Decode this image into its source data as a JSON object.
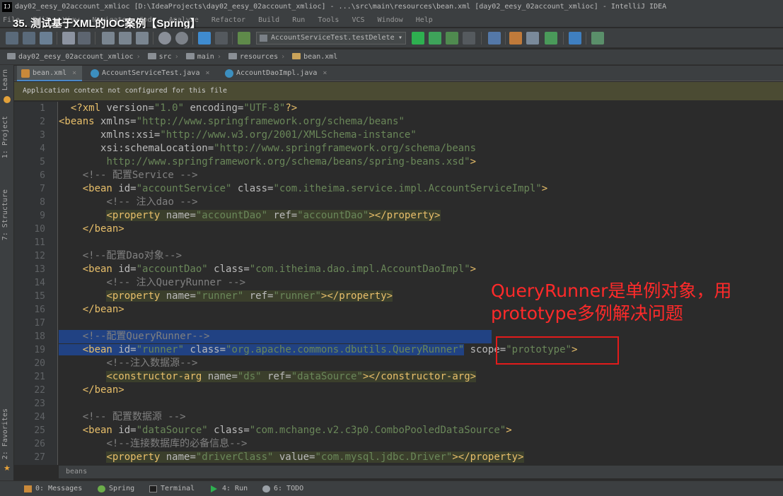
{
  "window": {
    "title": "day02_eesy_02account_xmlioc [D:\\IdeaProjects\\day02_eesy_02account_xmlioc] - ...\\src\\main\\resources\\bean.xml [day02_eesy_02account_xmlioc] - IntelliJ IDEA",
    "app_icon": "IJ"
  },
  "video_title": "35. 测试基于XML的IOC案例【Spring】",
  "menu": [
    "File",
    "Edit",
    "View",
    "Navigate",
    "Code",
    "Analyze",
    "Refactor",
    "Build",
    "Run",
    "Tools",
    "VCS",
    "Window",
    "Help"
  ],
  "toolbar": {
    "run_config": "AccountServiceTest.testDelete",
    "icons": [
      "save-icon",
      "sync-icon",
      "cut-icon",
      "copy-icon",
      "paste-icon",
      "find-icon",
      "replace-icon",
      "back-icon",
      "forward-icon",
      "build-icon",
      "run-icon",
      "debug-icon",
      "coverage-icon",
      "stop-icon",
      "structure-icon",
      "settings-icon",
      "project-structure-icon",
      "help-icon",
      "vm-icon"
    ]
  },
  "breadcrumb": [
    "day02_eesy_02account_xmlioc",
    "src",
    "main",
    "resources",
    "bean.xml"
  ],
  "left_stripe": {
    "learn": "Learn",
    "project": "1: Project",
    "structure": "7: Structure",
    "favorites": "2: Favorites"
  },
  "tabs": [
    {
      "label": "bean.xml",
      "active": true
    },
    {
      "label": "AccountServiceTest.java",
      "active": false
    },
    {
      "label": "AccountDaoImpl.java",
      "active": false
    }
  ],
  "notice": "Application context not configured for this file",
  "code": {
    "lines": [
      "1",
      "2",
      "3",
      "4",
      "5",
      "6",
      "7",
      "8",
      "9",
      "10",
      "11",
      "12",
      "13",
      "14",
      "15",
      "16",
      "17",
      "18",
      "19",
      "20",
      "21",
      "22",
      "23",
      "24",
      "25",
      "26",
      "27"
    ],
    "l1": {
      "a": "<?xml",
      "b": " version=",
      "c": "\"1.0\"",
      "d": " encoding=",
      "e": "\"UTF-8\"",
      "f": "?>"
    },
    "l2": {
      "a": "<beans",
      "b": " xmlns=",
      "c": "\"http://www.springframework.org/schema/beans\""
    },
    "l3": {
      "b": "xmlns:xsi=",
      "c": "\"http://www.w3.org/2001/XMLSchema-instance\""
    },
    "l4": {
      "b": "xsi:schemaLocation=",
      "c": "\"http://www.springframework.org/schema/beans"
    },
    "l5": {
      "c": "http://www.springframework.org/schema/beans/spring-beans.xsd\"",
      "f": ">"
    },
    "l6": "<!-- 配置Service -->",
    "l7": {
      "a": "<bean",
      "b1": " id=",
      "c1": "\"accountService\"",
      "b2": " class=",
      "c2": "\"com.itheima.service.impl.AccountServiceImpl\"",
      "f": ">"
    },
    "l8": "<!-- 注入dao -->",
    "l9": {
      "a": "<property",
      "b1": " name=",
      "c1": "\"accountDao\"",
      "b2": " ref=",
      "c2": "\"accountDao\"",
      "f": "></property>"
    },
    "l10": "</bean>",
    "l12": "<!--配置Dao对象-->",
    "l13": {
      "a": "<bean",
      "b1": " id=",
      "c1": "\"accountDao\"",
      "b2": " class=",
      "c2": "\"com.itheima.dao.impl.AccountDaoImpl\"",
      "f": ">"
    },
    "l14": "<!-- 注入QueryRunner -->",
    "l15": {
      "a": "<property",
      "b1": " name=",
      "c1": "\"runner\"",
      "b2": " ref=",
      "c2": "\"runner\"",
      "f": "></property>"
    },
    "l16": "</bean>",
    "l18": "<!--配置QueryRunner-->",
    "l19": {
      "a": "<bean",
      "b1": " id=",
      "c1": "\"runner\"",
      "b2": " class=",
      "c2": "\"org.apache.commons.dbutils.QueryRunner\"",
      "b3": " scope=",
      "c3": "\"prototype\"",
      "f": ">"
    },
    "l20": "<!--注入数据源-->",
    "l21": {
      "a": "<constructor-arg",
      "b1": " name=",
      "c1": "\"ds\"",
      "b2": " ref=",
      "c2": "\"dataSource\"",
      "f": "></constructor-arg>"
    },
    "l22": "</bean>",
    "l24": "<!-- 配置数据源 -->",
    "l25": {
      "a": "<bean",
      "b1": " id=",
      "c1": "\"dataSource\"",
      "b2": " class=",
      "c2": "\"com.mchange.v2.c3p0.ComboPooledDataSource\"",
      "f": ">"
    },
    "l26": "<!--连接数据库的必备信息-->",
    "l27": {
      "a": "<property",
      "b1": " name=",
      "c1": "\"driverClass\"",
      "b2": " value=",
      "c2": "\"com.mysql.jdbc.Driver\"",
      "f": "></property>"
    }
  },
  "editor_breadcrumb": "beans",
  "bottombar": [
    {
      "label": "0: Messages"
    },
    {
      "label": "Spring"
    },
    {
      "label": "Terminal"
    },
    {
      "label": "4: Run"
    },
    {
      "label": "6: TODO"
    }
  ],
  "annotation": {
    "line1": "QueryRunner是单例对象，用",
    "line2": "prototype多例解决问题",
    "color": "#ff2a2a"
  }
}
